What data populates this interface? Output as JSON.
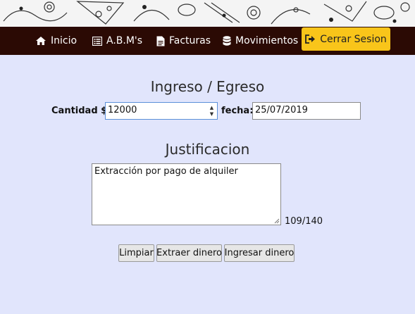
{
  "nav": {
    "items": [
      {
        "label": "Inicio",
        "icon": "home-icon"
      },
      {
        "label": "A.B.M's",
        "icon": "list-icon"
      },
      {
        "label": "Facturas",
        "icon": "document-icon"
      },
      {
        "label": "Movimientos",
        "icon": "database-icon"
      }
    ],
    "logout_label": "Cerrar Sesion",
    "logout_icon": "sign-out-icon"
  },
  "form": {
    "title": "Ingreso / Egreso",
    "amount_label": "Cantidad $",
    "amount_value": "12000",
    "date_label": "fecha:",
    "date_value": "25/07/2019",
    "justification_title": "Justificacion",
    "justification_value": "Extracción por pago de alquiler",
    "counter": "109/140"
  },
  "buttons": {
    "clear": "Limpiar",
    "withdraw": "Extraer dinero",
    "deposit": "Ingresar dinero"
  },
  "colors": {
    "navbar_bg": "#2b0a04",
    "logout_bg": "#f9c51a",
    "page_bg": "#e1e5fc"
  }
}
